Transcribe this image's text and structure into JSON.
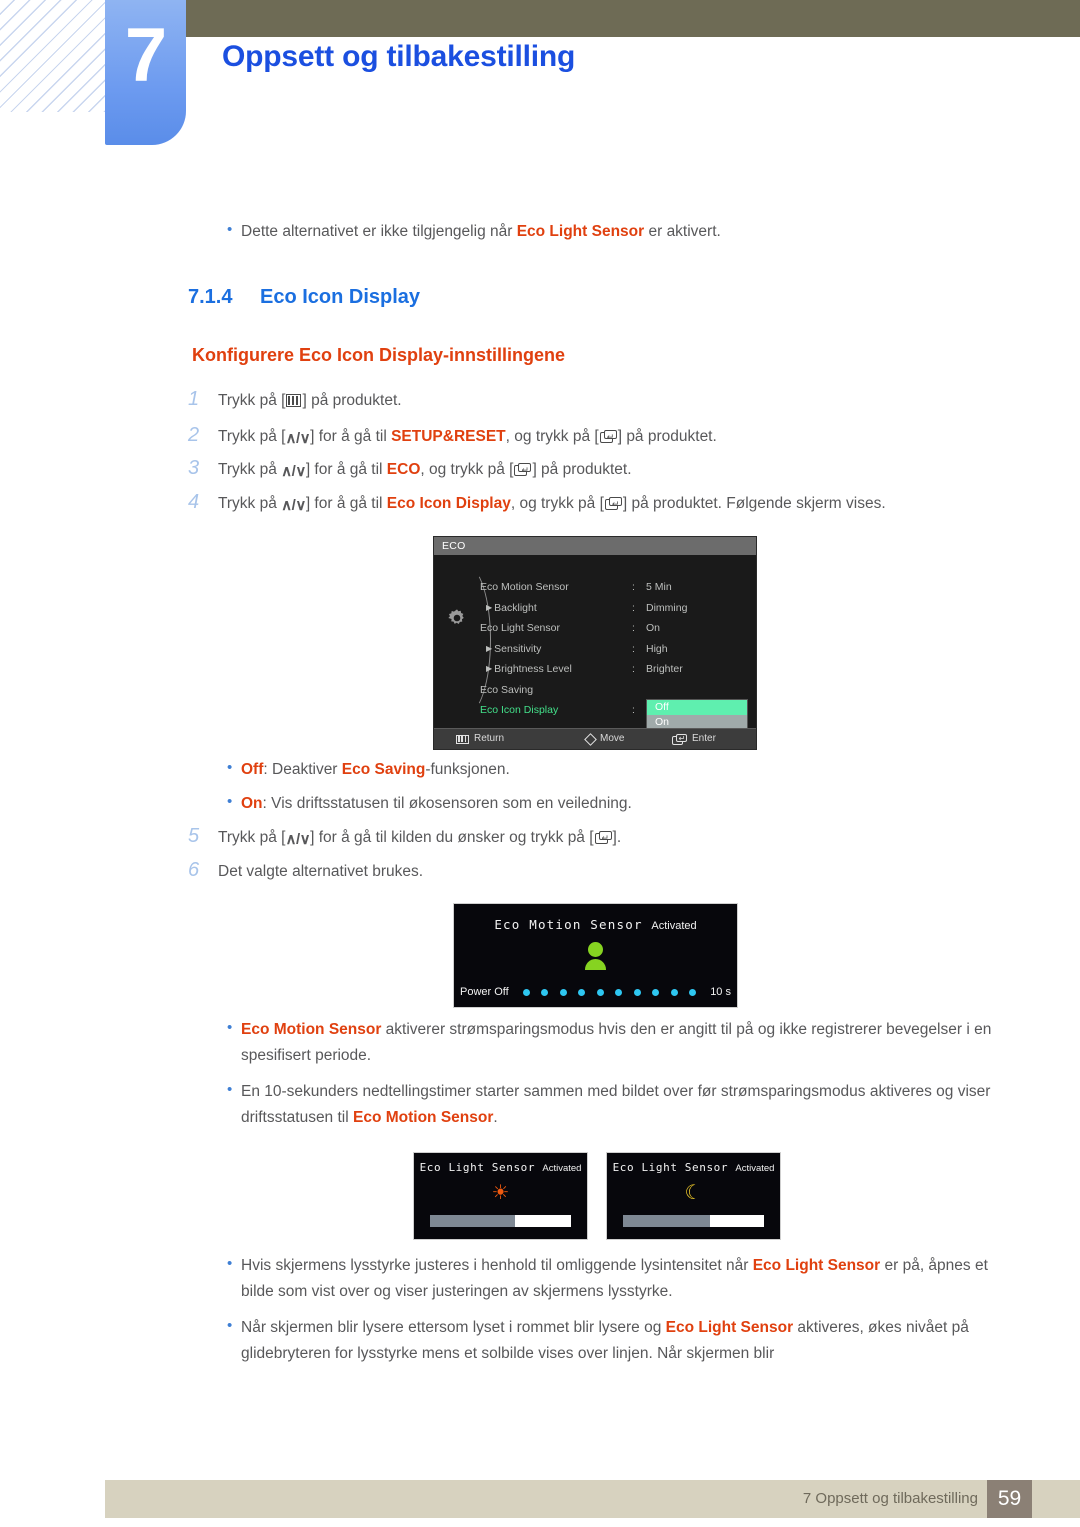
{
  "header": {
    "chapter_number": "7",
    "chapter_title": "Oppsett og tilbakestilling"
  },
  "intro_note": {
    "text_before": "Dette alternativet er ikke tilgjengelig når ",
    "highlight": "Eco Light Sensor",
    "text_after": " er aktivert."
  },
  "section": {
    "number": "7.1.4",
    "title": "Eco Icon Display",
    "subheading": "Konfigurere Eco Icon Display-innstillingene"
  },
  "steps": [
    {
      "num": "1",
      "parts": [
        {
          "t": "text",
          "v": "Trykk på ["
        },
        {
          "t": "icon",
          "v": "menu-icon"
        },
        {
          "t": "text",
          "v": "] på produktet."
        }
      ]
    },
    {
      "num": "2",
      "parts": [
        {
          "t": "text",
          "v": "Trykk på ["
        },
        {
          "t": "icon",
          "v": "up-down-icon"
        },
        {
          "t": "text",
          "v": "] for å gå til "
        },
        {
          "t": "hl",
          "v": "SETUP&RESET"
        },
        {
          "t": "text",
          "v": ", og trykk på ["
        },
        {
          "t": "icon",
          "v": "enter-icon"
        },
        {
          "t": "text",
          "v": "] på produktet."
        }
      ]
    },
    {
      "num": "3",
      "parts": [
        {
          "t": "text",
          "v": "Trykk på "
        },
        {
          "t": "icon",
          "v": "up-down-icon"
        },
        {
          "t": "text",
          "v": "] for å gå til "
        },
        {
          "t": "hl",
          "v": "ECO"
        },
        {
          "t": "text",
          "v": ", og trykk på ["
        },
        {
          "t": "icon",
          "v": "enter-icon"
        },
        {
          "t": "text",
          "v": "] på produktet."
        }
      ]
    },
    {
      "num": "4",
      "parts": [
        {
          "t": "text",
          "v": "Trykk på "
        },
        {
          "t": "icon",
          "v": "up-down-icon"
        },
        {
          "t": "text",
          "v": "] for å gå til  "
        },
        {
          "t": "hl",
          "v": "Eco Icon Display"
        },
        {
          "t": "text",
          "v": ", og trykk på ["
        },
        {
          "t": "icon",
          "v": "enter-icon"
        },
        {
          "t": "text",
          "v": "] på produktet. Følgende skjerm vises."
        }
      ]
    },
    {
      "num": "5",
      "parts": [
        {
          "t": "text",
          "v": "Trykk på ["
        },
        {
          "t": "icon",
          "v": "up-down-icon"
        },
        {
          "t": "text",
          "v": "] for å gå til kilden du ønsker og trykk på ["
        },
        {
          "t": "icon",
          "v": "enter-icon"
        },
        {
          "t": "text",
          "v": "]."
        }
      ]
    },
    {
      "num": "6",
      "parts": [
        {
          "t": "text",
          "v": "Det valgte alternativet brukes."
        }
      ]
    }
  ],
  "osd": {
    "title": "ECO",
    "gear_icon": "gear-icon",
    "rows": [
      {
        "label": "Eco Motion Sensor",
        "value": "5 Min",
        "indent": false,
        "arrow": false,
        "active": false
      },
      {
        "label": "Backlight",
        "value": "Dimming",
        "indent": true,
        "arrow": true,
        "active": false
      },
      {
        "label": "Eco Light Sensor",
        "value": "On",
        "indent": false,
        "arrow": false,
        "active": false
      },
      {
        "label": "Sensitivity",
        "value": "High",
        "indent": true,
        "arrow": true,
        "active": false
      },
      {
        "label": "Brightness Level",
        "value": "Brighter",
        "indent": true,
        "arrow": true,
        "active": false
      },
      {
        "label": "Eco Saving",
        "value": "",
        "indent": false,
        "arrow": false,
        "active": false
      },
      {
        "label": "Eco Icon Display",
        "value": "",
        "indent": false,
        "arrow": false,
        "active": true
      }
    ],
    "dropdown": {
      "selected": "Off",
      "unselected": "On"
    },
    "footer": {
      "return_label": "Return",
      "move_label": "Move",
      "enter_label": "Enter"
    }
  },
  "option_notes": [
    {
      "key": "Off",
      "text_before": ": Deaktiver ",
      "highlight": "Eco Saving",
      "text_after": "-funksjonen."
    },
    {
      "key": "On",
      "text_before": ": Vis driftsstatusen til økosensoren som en veiledning.",
      "highlight": "",
      "text_after": ""
    }
  ],
  "motion_screen": {
    "title_mono": "Eco Motion Sensor",
    "title_small": "Activated",
    "power_off_label": "Power Off",
    "countdown": "10 s",
    "dot_count": 10,
    "person_icon": "person-icon",
    "dot_color": "#2ec7f2",
    "person_color": "#86d321"
  },
  "motion_notes": [
    {
      "segments": [
        {
          "t": "hl",
          "v": "Eco Motion Sensor"
        },
        {
          "t": "text",
          "v": " aktiverer strømsparingsmodus hvis den er angitt til på og ikke registrerer bevegelser i en spesifisert periode."
        }
      ]
    },
    {
      "segments": [
        {
          "t": "text",
          "v": "En 10-sekunders nedtellingstimer starter sammen med bildet over før strømsparingsmodus aktiveres og viser driftsstatusen til "
        },
        {
          "t": "hl",
          "v": "Eco Motion Sensor"
        },
        {
          "t": "text",
          "v": "."
        }
      ]
    }
  ],
  "light_screens": [
    {
      "title_mono": "Eco Light Sensor",
      "title_small": "Activated",
      "icon": "sun-icon",
      "icon_glyph": "☀",
      "icon_color": "#ef5a10",
      "slider_fill_percent": 60
    },
    {
      "title_mono": "Eco Light Sensor",
      "title_small": "Activated",
      "icon": "moon-icon",
      "icon_glyph": "☾",
      "icon_color": "#e8c42a",
      "slider_fill_percent": 62
    }
  ],
  "light_notes": [
    {
      "segments": [
        {
          "t": "text",
          "v": "Hvis skjermens lysstyrke justeres i henhold til omliggende lysintensitet når "
        },
        {
          "t": "hl",
          "v": "Eco Light Sensor"
        },
        {
          "t": "text",
          "v": " er på, åpnes et bilde som vist over og viser justeringen av skjermens lysstyrke."
        }
      ]
    },
    {
      "segments": [
        {
          "t": "text",
          "v": "Når skjermen blir lysere ettersom lyset i rommet blir lysere og "
        },
        {
          "t": "hl",
          "v": "Eco Light Sensor"
        },
        {
          "t": "text",
          "v": " aktiveres, økes nivået på glidebryteren for lysstyrke mens et solbilde vises over linjen. Når skjermen blir"
        }
      ]
    }
  ],
  "footer": {
    "text": "7 Oppsett og tilbakestilling",
    "page_number": "59"
  },
  "colors": {
    "accent_red": "#e0400f",
    "accent_blue": "#1b6fe0",
    "header_olive": "#6e6b55",
    "tab_blue": "#6d9bf0",
    "footer_bar": "#d7d2bf",
    "footer_page": "#8b8075"
  }
}
